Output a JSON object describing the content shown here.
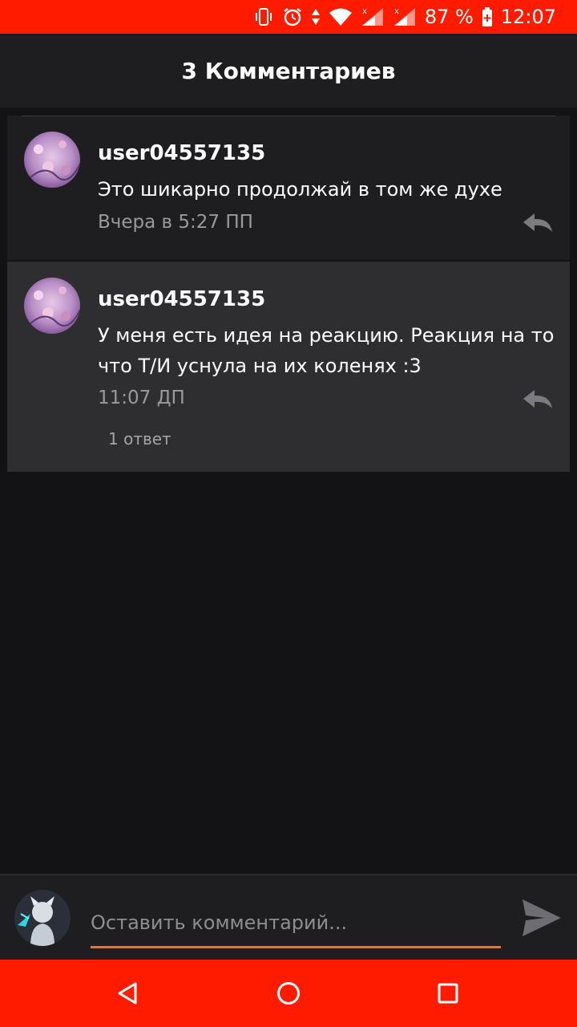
{
  "status_bar": {
    "battery": "87 %",
    "time": "12:07",
    "icons": [
      "vibrate-icon",
      "alarm-icon",
      "data-arrows-icon",
      "wifi-icon",
      "signal-icon",
      "signal-icon",
      "battery-icon"
    ]
  },
  "header": {
    "title": "3 Комментариев"
  },
  "comments": [
    {
      "username": "user04557135",
      "text": "Это шикарно продолжай в том же духе",
      "timestamp": "Вчера в 5:27 ПП"
    },
    {
      "username": "user04557135",
      "text": "У меня есть идея на реакцию. Реакция на то что Т/И уснула на их коленях :3",
      "timestamp": "11:07 ДП",
      "replies": "1 ответ"
    }
  ],
  "composer": {
    "placeholder": "Оставить комментарий...",
    "value": ""
  },
  "colors": {
    "accent": "#ff1b00",
    "input_underline": "#ff6a2f",
    "background": "#131215"
  }
}
